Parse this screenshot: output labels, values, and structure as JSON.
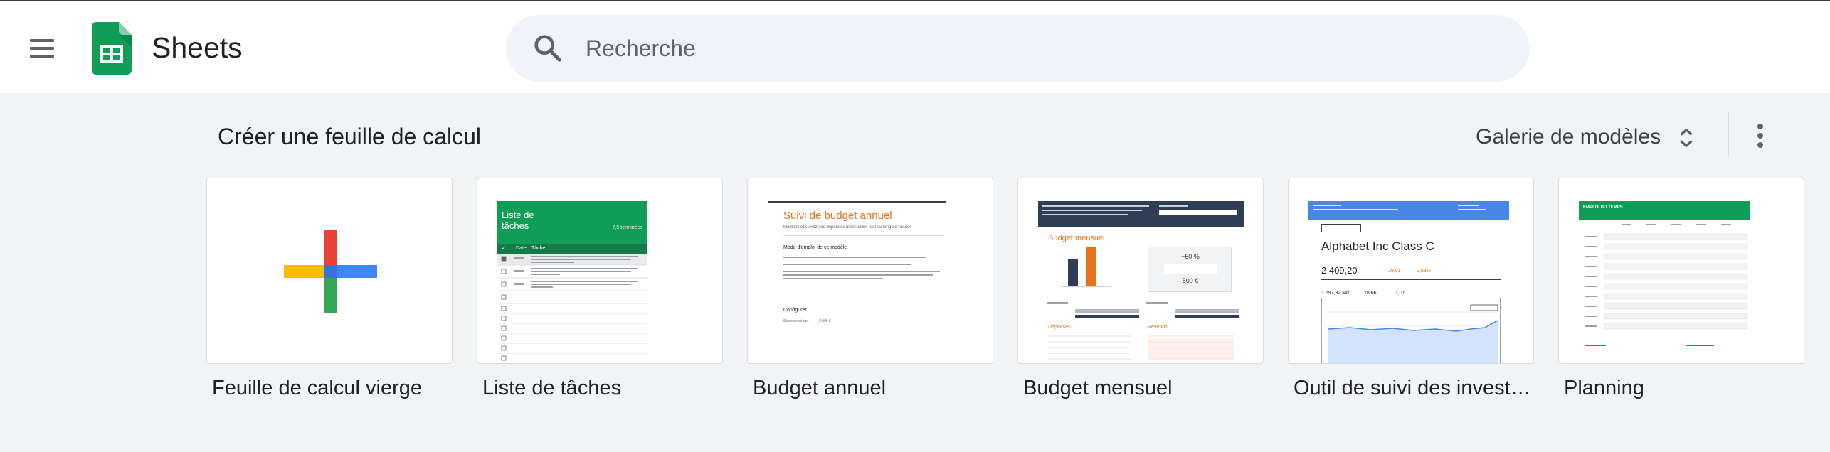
{
  "header": {
    "app_name": "Sheets",
    "search": {
      "placeholder": "Recherche"
    }
  },
  "section": {
    "title": "Créer une feuille de calcul",
    "gallery_label": "Galerie de modèles"
  },
  "colors": {
    "brand_green": "#0f9d58",
    "plus_red": "#ea4335",
    "plus_yellow": "#fbbc04",
    "plus_blue": "#4285f4",
    "plus_green": "#34a853"
  },
  "templates": [
    {
      "label": "Feuille de calcul vierge",
      "icon": "plus-icon"
    },
    {
      "label": "Liste de tâches",
      "preview": {
        "title": "Liste de tâches",
        "subtitle": "7,5 terminées",
        "col_done": "✓",
        "col_date": "Date",
        "col_task": "Tâche"
      }
    },
    {
      "label": "Budget annuel",
      "preview": {
        "title": "Suivi de budget annuel",
        "subtitle": "Modifiez et suivez vos dépenses mensuelles tout au long de l'année",
        "section": "Mode d'emploi de ce modèle",
        "config": "Configurer",
        "config_row": "Solde de départ",
        "config_value": "2 000 €"
      }
    },
    {
      "label": "Budget mensuel",
      "preview": {
        "title": "Budget mensuel",
        "percent": "+50 %",
        "amount": "500 €",
        "expenses": "Dépenses",
        "income": "Revenus"
      }
    },
    {
      "label": "Outil de suivi des investissements",
      "preview": {
        "company": "Alphabet Inc Class C",
        "price": "2 409,20",
        "change_abs": "29,61",
        "change_pct": "0,83%",
        "market_cap": "1 597,92 Md",
        "pe": "28,66",
        "beta": "1,01"
      }
    },
    {
      "label": "Planning",
      "preview": {
        "title": "EMPLOI DU TEMPS"
      }
    }
  ]
}
